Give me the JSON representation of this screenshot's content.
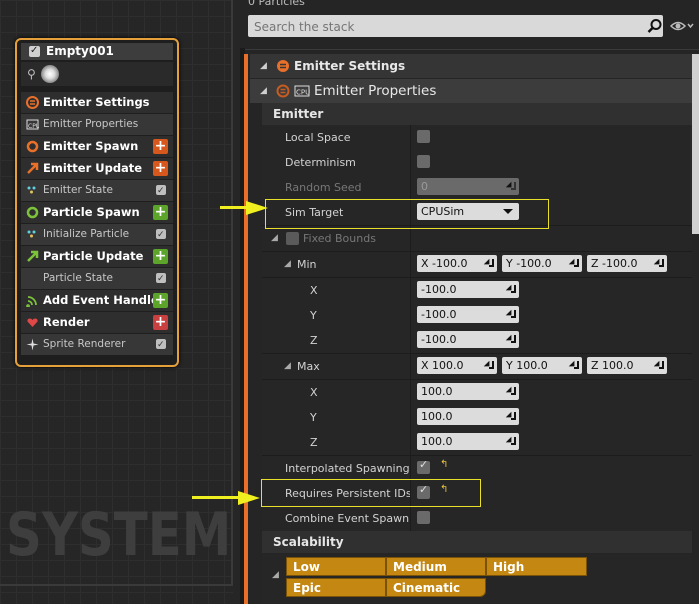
{
  "graph": {
    "watermark": "SYSTEM",
    "node": {
      "title": "Empty001",
      "rows": [
        {
          "label": "Emitter Settings",
          "kind": "major",
          "icon": "emitter-settings-icon",
          "color": "#e8702a"
        },
        {
          "label": "Emitter Properties",
          "kind": "minor",
          "icon": "cpu-icon"
        },
        {
          "label": "Emitter Spawn",
          "kind": "major",
          "icon": "ring-icon",
          "color": "#e8702a",
          "add": "#d7581c"
        },
        {
          "label": "Emitter Update",
          "kind": "major",
          "icon": "arrow-icon",
          "color": "#e8702a",
          "add": "#d7581c"
        },
        {
          "label": "Emitter State",
          "kind": "minor",
          "icon": "dots-icon",
          "check": true
        },
        {
          "label": "Particle Spawn",
          "kind": "major",
          "icon": "ring-icon",
          "color": "#7cc23b",
          "add": "#5da52a"
        },
        {
          "label": "Initialize Particle",
          "kind": "minor",
          "icon": "dots-icon",
          "check": true
        },
        {
          "label": "Particle Update",
          "kind": "major",
          "icon": "arrow-icon",
          "color": "#7cc23b",
          "add": "#5da52a"
        },
        {
          "label": "Particle State",
          "kind": "minor",
          "icon": "none",
          "check": true
        },
        {
          "label": "Add Event Handler",
          "kind": "major",
          "icon": "signal-icon",
          "color": "#7cc23b",
          "add": "#5da52a"
        },
        {
          "label": "Render",
          "kind": "major",
          "icon": "heart-icon",
          "color": "#e04848",
          "add": "#c94040"
        },
        {
          "label": "Sprite Renderer",
          "kind": "minor",
          "icon": "spark-icon",
          "check": true
        }
      ]
    }
  },
  "stack": {
    "particles_label": "0 Particles",
    "search_placeholder": "Search the stack",
    "emitter_settings_header": "Emitter Settings",
    "emitter_properties_header": "Emitter Properties",
    "emitter_section": "Emitter",
    "props": {
      "local_space": "Local Space",
      "determinism": "Determinism",
      "random_seed": "Random Seed",
      "random_seed_value": "0",
      "sim_target": "Sim Target",
      "sim_target_value": "CPUSim",
      "fixed_bounds": "Fixed Bounds",
      "min": "Min",
      "max": "Max",
      "x": "X",
      "y": "Y",
      "z": "Z",
      "min_vec": {
        "x": "X  -100.0",
        "y": "Y  -100.0",
        "z": "Z  -100.0"
      },
      "min_x": "-100.0",
      "min_y": "-100.0",
      "min_z": "-100.0",
      "max_vec": {
        "x": "X  100.0",
        "y": "Y  100.0",
        "z": "Z  100.0"
      },
      "max_x": "100.0",
      "max_y": "100.0",
      "max_z": "100.0",
      "interpolated_spawning": "Interpolated Spawning",
      "requires_persistent_ids": "Requires Persistent IDs",
      "combine_event_spawn": "Combine Event Spawn"
    },
    "scalability_section": "Scalability",
    "scalability": {
      "low": "Low",
      "medium": "Medium",
      "high": "High",
      "epic": "Epic",
      "cinematic": "Cinematic"
    }
  },
  "colors": {
    "accent_orange": "#e8702a",
    "highlight_yellow": "#f0f020",
    "scalability_gold": "#c38712"
  }
}
